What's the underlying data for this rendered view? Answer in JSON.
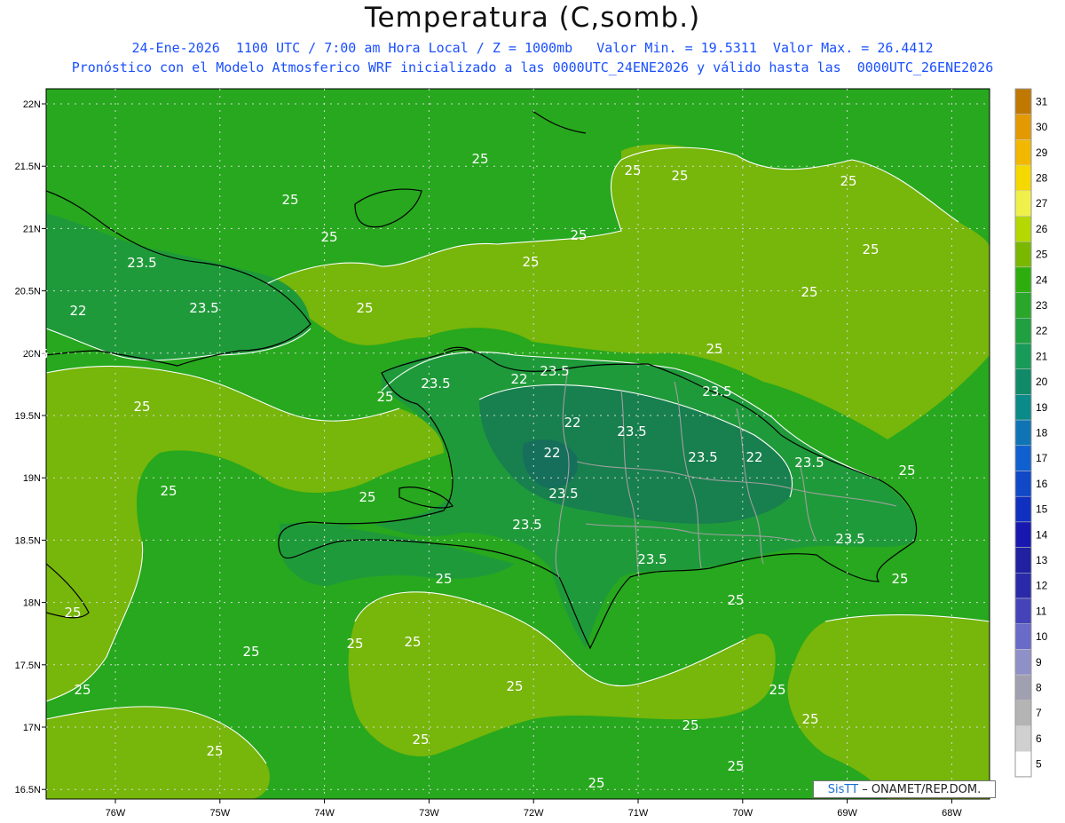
{
  "header": {
    "title": "Temperatura (C,somb.)",
    "line1": "24-Ene-2026  1100 UTC / 7:00 am Hora Local / Z = 1000mb   Valor Min. = 19.5311  Valor Max. = 26.4412",
    "line2": "Pronóstico con el Modelo Atmosferico WRF inicializado a las 0000UTC_24ENE2026 y válido hasta las  0000UTC_26ENE2026"
  },
  "axes": {
    "lat_labels": [
      "22N",
      "21.5N",
      "21N",
      "20.5N",
      "20N",
      "19.5N",
      "19N",
      "18.5N",
      "18N",
      "17.5N",
      "17N",
      "16.5N"
    ],
    "lon_labels": [
      "76W",
      "75W",
      "74W",
      "73W",
      "72W",
      "71W",
      "70W",
      "69W",
      "68W"
    ]
  },
  "colorbar": {
    "levels": [
      "31",
      "30",
      "29",
      "28",
      "27",
      "26",
      "25",
      "24",
      "23",
      "22",
      "21",
      "20",
      "19",
      "18",
      "17",
      "16",
      "15",
      "14",
      "13",
      "12",
      "11",
      "10",
      "9",
      "8",
      "7",
      "6",
      "5"
    ],
    "colors": [
      "#c07800",
      "#e29a00",
      "#f2b800",
      "#f5d800",
      "#f0f04a",
      "#b5d800",
      "#7ab800",
      "#2eae0e",
      "#2aa62a",
      "#20a040",
      "#189a58",
      "#108a68",
      "#0a8a88",
      "#1074b4",
      "#1060d0",
      "#1048c8",
      "#1030c0",
      "#1818b0",
      "#2020a0",
      "#2a2aa8",
      "#4444b8",
      "#6a6ac8",
      "#9090c8",
      "#a0a0b0",
      "#b4b4b4",
      "#d0d0d0",
      "#ffffff"
    ]
  },
  "contour_labels": [
    "25",
    "23.5",
    "22"
  ],
  "credit": {
    "brand": "SisTT",
    "text": " – ONAMET/REP.DOM."
  },
  "colors": {
    "land_green": "#2aa62a",
    "warm_green": "#7ab800",
    "cool_green": "#208c4c"
  }
}
